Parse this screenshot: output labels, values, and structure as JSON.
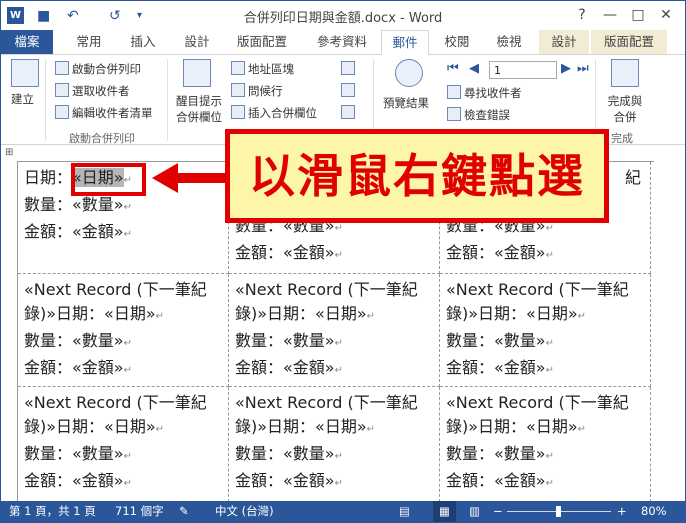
{
  "window": {
    "title": "合併列印日期與金額.docx - Word",
    "help": "?",
    "min": "—",
    "max": "□",
    "close": "✕"
  },
  "app": {
    "logo": "W"
  },
  "qat": {
    "save": "■",
    "undo": "↶",
    "redo": "↺",
    "more": "▾"
  },
  "tabs": [
    {
      "label": "檔案"
    },
    {
      "label": "常用"
    },
    {
      "label": "插入"
    },
    {
      "label": "設計"
    },
    {
      "label": "版面配置"
    },
    {
      "label": "參考資料"
    },
    {
      "label": "郵件"
    },
    {
      "label": "校閱"
    },
    {
      "label": "檢視"
    },
    {
      "label": "設計"
    },
    {
      "label": "版面配置"
    }
  ],
  "ribbon": {
    "create": "建立",
    "start_merge": "啟動合併列印",
    "select_recipients": "選取收件者",
    "edit_recipients": "編輯收件者清單",
    "group_start": "啟動合併列印",
    "highlight_fields_1": "醒目提示",
    "highlight_fields_2": "合併欄位",
    "address_block": "地址區塊",
    "greeting_line": "問候行",
    "insert_merge_field": "插入合併欄位",
    "preview_results": "預覽結果",
    "record": "1",
    "find_recipient": "尋找收件者",
    "check_errors": "檢查錯誤",
    "finish_1": "完成與",
    "finish_2": "合併",
    "group_finish": "完成"
  },
  "doc": {
    "row1": {
      "date_label": "日期：",
      "date_field": "«日期»",
      "qty": "數量：«數量»",
      "amt": "金額：«金額»"
    },
    "row1_col2": {
      "qty": "數量：«數量»",
      "amt": "金額：«金額»"
    },
    "row1_col3": {
      "tail": "紀",
      "qty": "數量：«數量»",
      "amt": "金額：«金額»"
    },
    "next_line1": "«Next Record (下一筆紀",
    "next_line2": "錄)»日期：«日期»",
    "qty": "數量：«數量»",
    "amt": "金額：«金額»",
    "para_mark": "↵"
  },
  "status": {
    "page": "第 1 頁，共 1 頁",
    "words": "711 個字",
    "lang": "中文 (台灣)",
    "zoom_minus": "−",
    "zoom_plus": "+",
    "zoom": "80%"
  },
  "annotation": {
    "callout": "以滑鼠右鍵點選"
  },
  "colors": {
    "accent": "#2b579a",
    "annotation": "#e00000",
    "callout_bg": "#fdf6a8"
  }
}
